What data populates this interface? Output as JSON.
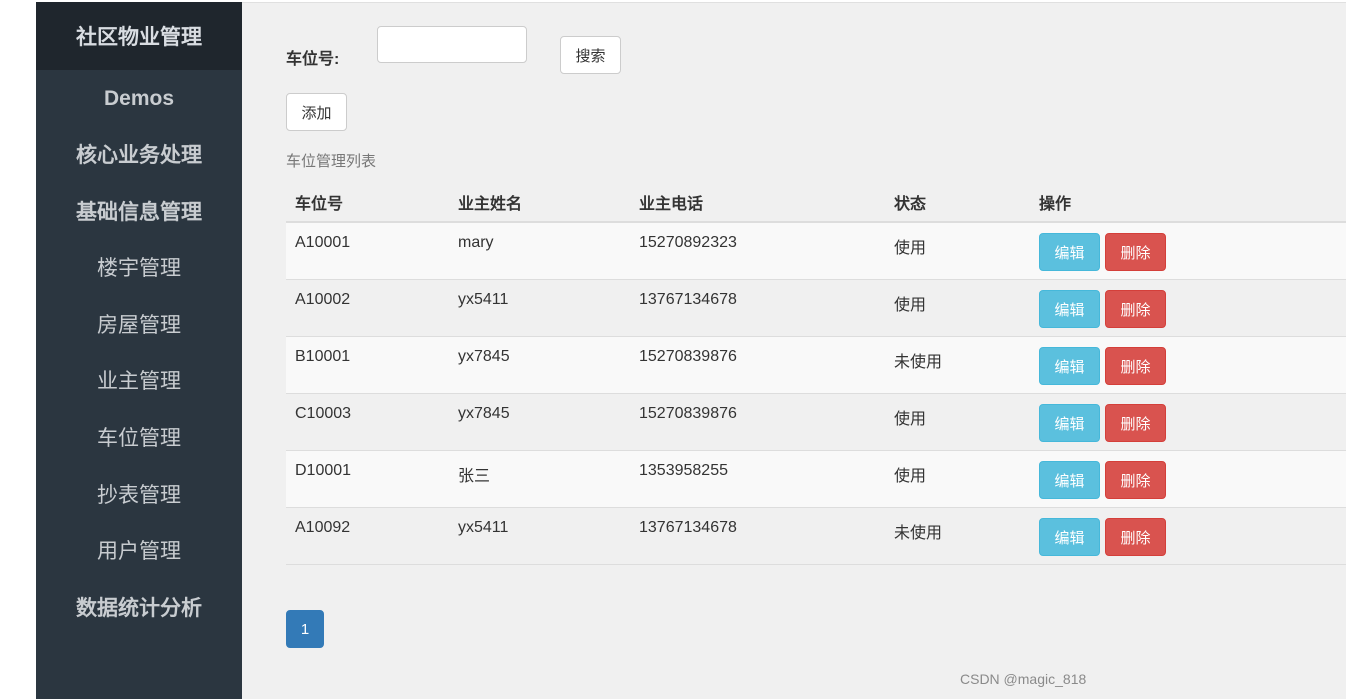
{
  "sidebar": {
    "brand": "社区物业管理",
    "items": [
      {
        "label": "Demos",
        "kind": "heading"
      },
      {
        "label": "核心业务处理",
        "kind": "heading"
      },
      {
        "label": "基础信息管理",
        "kind": "heading"
      },
      {
        "label": "楼宇管理",
        "kind": "sub"
      },
      {
        "label": "房屋管理",
        "kind": "sub"
      },
      {
        "label": "业主管理",
        "kind": "sub"
      },
      {
        "label": "车位管理",
        "kind": "sub"
      },
      {
        "label": "抄表管理",
        "kind": "sub"
      },
      {
        "label": "用户管理",
        "kind": "sub"
      },
      {
        "label": "数据统计分析",
        "kind": "heading"
      }
    ]
  },
  "search": {
    "label": "车位号:",
    "value": "",
    "placeholder": "",
    "button_label": "搜索"
  },
  "toolbar": {
    "add_label": "添加"
  },
  "list": {
    "caption": "车位管理列表",
    "columns": [
      "车位号",
      "业主姓名",
      "业主电话",
      "状态",
      "操作"
    ],
    "rows": [
      {
        "slot": "A10001",
        "owner": "mary",
        "phone": "15270892323",
        "status": "使用"
      },
      {
        "slot": "A10002",
        "owner": "yx5411",
        "phone": "13767134678",
        "status": "使用"
      },
      {
        "slot": "B10001",
        "owner": "yx7845",
        "phone": "15270839876",
        "status": "未使用"
      },
      {
        "slot": "C10003",
        "owner": "yx7845",
        "phone": "15270839876",
        "status": "使用"
      },
      {
        "slot": "D10001",
        "owner": "张三",
        "phone": "1353958255",
        "status": "使用"
      },
      {
        "slot": "A10092",
        "owner": "yx5411",
        "phone": "13767134678",
        "status": "未使用"
      }
    ],
    "edit_label": "编辑",
    "delete_label": "删除"
  },
  "pagination": {
    "current_page": "1"
  },
  "watermark": "CSDN @magic_818",
  "colors": {
    "sidebar_bg": "#2b3640",
    "brand_bg": "#1f262d",
    "edit_btn": "#5bc0de",
    "delete_btn": "#d9534f",
    "page_active": "#337ab7"
  }
}
